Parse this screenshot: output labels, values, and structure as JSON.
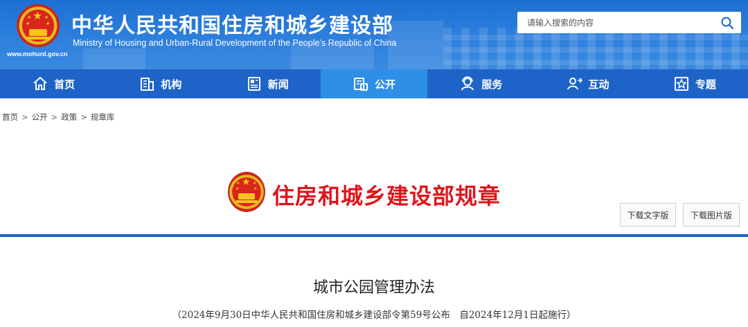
{
  "header": {
    "title": "中华人民共和国住房和城乡建设部",
    "subtitle": "Ministry of Housing and Urban-Rural Development of the People’s Republic of China",
    "url": "www.mohurd.gov.cn",
    "search": {
      "placeholder": "请输入搜索的内容",
      "icon": "search-icon"
    }
  },
  "nav": {
    "items": [
      {
        "label": "首页",
        "icon": "home-icon"
      },
      {
        "label": "机构",
        "icon": "building-icon"
      },
      {
        "label": "新闻",
        "icon": "news-icon"
      },
      {
        "label": "公开",
        "icon": "disclosure-icon",
        "active": true
      },
      {
        "label": "服务",
        "icon": "service-icon"
      },
      {
        "label": "互动",
        "icon": "interaction-icon"
      },
      {
        "label": "专题",
        "icon": "topic-star-icon"
      }
    ]
  },
  "breadcrumb": {
    "items": [
      "首页",
      "公开",
      "政策",
      "规章库"
    ],
    "separator": ">"
  },
  "banner": {
    "title": "住房和城乡建设部规章",
    "download_text_label": "下载文字版",
    "download_image_label": "下载图片版"
  },
  "article": {
    "title": "城市公园管理办法",
    "subtitle": "（2024年9月30日中华人民共和国住房和城乡建设部令第59号公布　自2024年12月1日起施行）"
  },
  "colors": {
    "header_blue": "#2a7ddc",
    "nav_blue": "#1e64c8",
    "nav_active": "#2f8ee6",
    "banner_red": "#e0141b"
  }
}
